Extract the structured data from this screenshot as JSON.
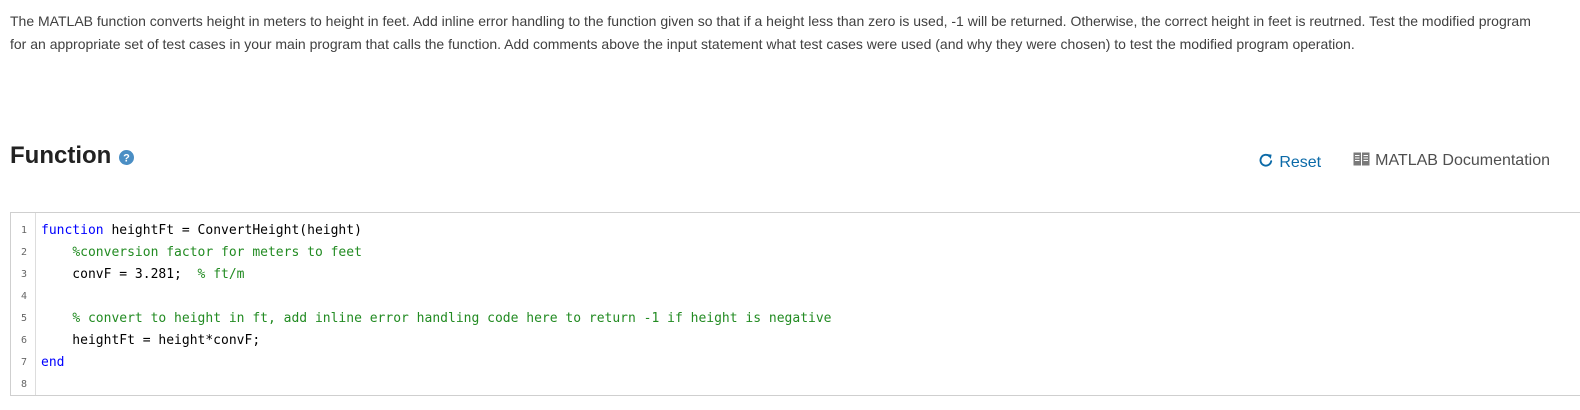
{
  "problem": {
    "description": "The MATLAB function converts height in meters to height in feet. Add inline error handling to the function given so that if a height less than zero is used, -1 will be returned. Otherwise, the correct height in feet is reutrned. Test the modified program for an appropriate set of test cases in your main program that calls the function. Add comments above the input statement what test cases were used (and why they were chosen) to test the modified program operation."
  },
  "section": {
    "title": "Function",
    "help_icon": "question-circle-icon"
  },
  "actions": {
    "reset_label": "Reset",
    "reset_icon": "refresh-icon",
    "docs_label": "MATLAB Documentation",
    "docs_icon": "book-icon"
  },
  "editor": {
    "lines": [
      {
        "number": "1",
        "parts": [
          {
            "kind": "keyword",
            "text": "function"
          },
          {
            "kind": "text",
            "text": " heightFt = ConvertHeight(height)"
          }
        ]
      },
      {
        "number": "2",
        "parts": [
          {
            "kind": "text",
            "text": "    "
          },
          {
            "kind": "comment",
            "text": "%conversion factor for meters to feet"
          }
        ]
      },
      {
        "number": "3",
        "parts": [
          {
            "kind": "text",
            "text": "    convF = 3.281;  "
          },
          {
            "kind": "comment",
            "text": "% ft/m"
          }
        ]
      },
      {
        "number": "4",
        "parts": []
      },
      {
        "number": "5",
        "parts": [
          {
            "kind": "text",
            "text": "    "
          },
          {
            "kind": "comment",
            "text": "% convert to height in ft, add inline error handling code here to return -1 if height is negative"
          }
        ]
      },
      {
        "number": "6",
        "parts": [
          {
            "kind": "text",
            "text": "    heightFt = height*convF;"
          }
        ]
      },
      {
        "number": "7",
        "parts": [
          {
            "kind": "keyword",
            "text": "end"
          }
        ]
      },
      {
        "number": "8",
        "parts": []
      }
    ]
  },
  "colors": {
    "keyword": "#0000ff",
    "comment": "#228b22",
    "link": "#0b6aa8",
    "help_icon": "#4a8ec4"
  }
}
